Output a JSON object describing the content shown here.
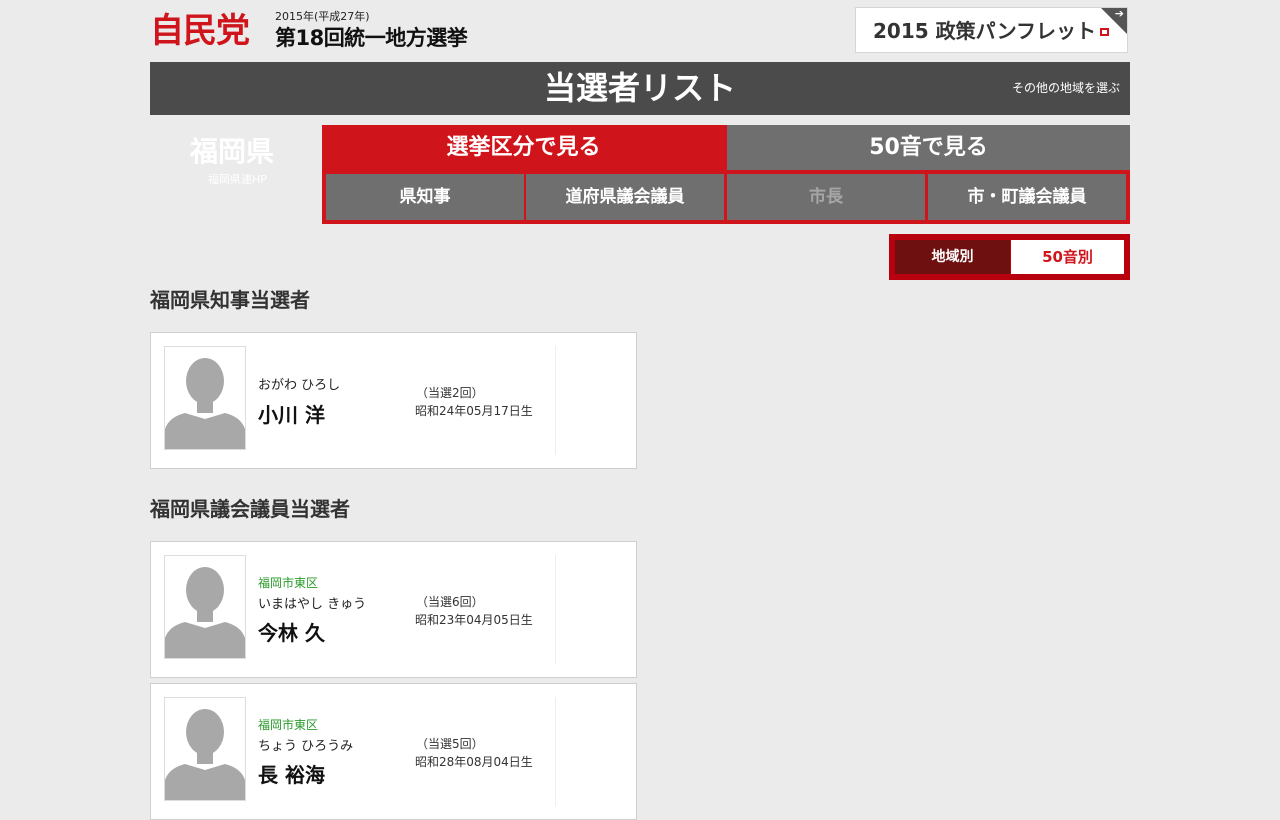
{
  "header": {
    "logo": "自民党",
    "year_line": "2015年(平成27年)",
    "election_title": "第18回統一地方選挙",
    "pamphlet_label": "2015 政策パンフレット",
    "pamphlet_arrow": "➔"
  },
  "titlebar": {
    "title": "当選者リスト",
    "other_region": "その他の地域を選ぶ"
  },
  "prefecture": {
    "name": "福岡県",
    "hp_link": "福岡県連HP"
  },
  "tabs": {
    "main": [
      {
        "label": "選挙区分で見る"
      },
      {
        "label": "50音で見る"
      }
    ],
    "sub": [
      {
        "label": "県知事"
      },
      {
        "label": "道府県議会議員"
      },
      {
        "label": "市長"
      },
      {
        "label": "市・町議会議員"
      }
    ]
  },
  "sort_toggle": {
    "by_region": "地域別",
    "by_kana": "50音別"
  },
  "sections": [
    {
      "title": "福岡県知事当選者",
      "candidates": [
        {
          "area": "",
          "kana": "おがわ ひろし",
          "name": "小川 洋",
          "times": "（当選2回）",
          "birth": "昭和24年05月17日生"
        }
      ]
    },
    {
      "title": "福岡県議会議員当選者",
      "candidates": [
        {
          "area": "福岡市東区",
          "kana": "いまはやし きゅう",
          "name": "今林 久",
          "times": "（当選6回）",
          "birth": "昭和23年04月05日生"
        },
        {
          "area": "福岡市東区",
          "kana": "ちょう ひろうみ",
          "name": "長 裕海",
          "times": "（当選5回）",
          "birth": "昭和28年08月04日生"
        }
      ]
    }
  ],
  "colors": {
    "brand_red": "#d0141b",
    "dark_bar": "#4b4b4b",
    "tab_gray": "#6f6f6f",
    "area_green": "#2a9a2a"
  }
}
